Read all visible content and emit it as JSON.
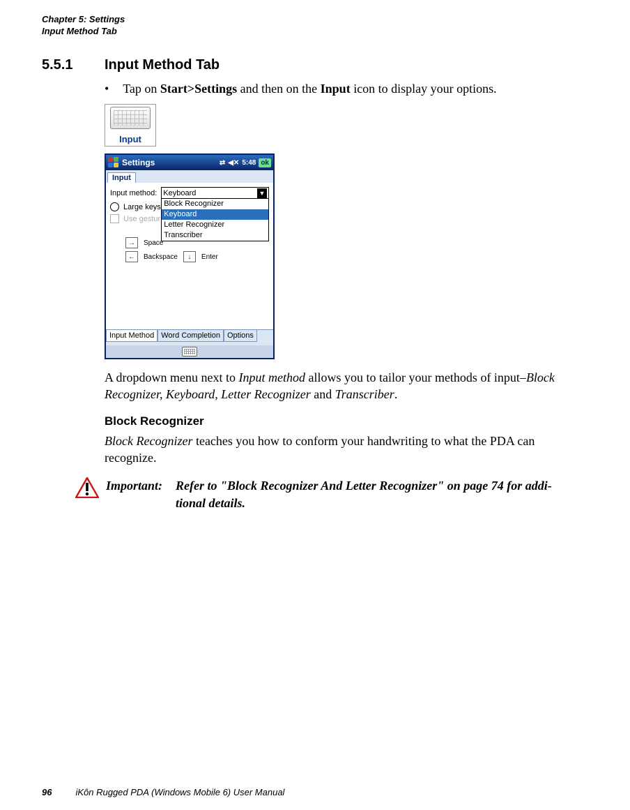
{
  "running_head": {
    "line1": "Chapter 5: Settings",
    "line2": "Input Method Tab"
  },
  "section": {
    "number": "5.5.1",
    "title": "Input Method Tab"
  },
  "bullet": {
    "marker": "•",
    "pre": "Tap on ",
    "bold1": "Start>Settings",
    "mid": " and then on the ",
    "bold2": "Input",
    "post": " icon to display your options."
  },
  "icon_tile": {
    "label": "Input"
  },
  "device": {
    "titlebar": {
      "title": "Settings",
      "signal_glyph": "⇄",
      "sound_glyph": "◀✕",
      "time": "5:48",
      "ok": "ok"
    },
    "top_tab": "Input",
    "panel": {
      "input_method_label": "Input method:",
      "selected": "Keyboard",
      "options": [
        "Block Recognizer",
        "Keyboard",
        "Letter Recognizer",
        "Transcriber"
      ],
      "large_keys": "Large keys",
      "use_gestures": "Use gestures",
      "space_label": "Space",
      "backspace_label": "Backspace",
      "enter_label": "Enter"
    },
    "bottom_tabs": [
      "Input Method",
      "Word Completion",
      "Options"
    ]
  },
  "paragraph1": {
    "pre": "A dropdown menu next to ",
    "it1": "Input method",
    "mid1": " allows you to tailor your methods of input–",
    "it2": "Block Recognizer, Keyboard, Letter Recognizer",
    "mid2": " and ",
    "it3": "Transcriber",
    "post": "."
  },
  "subhead": "Block Recognizer",
  "paragraph2": {
    "it1": "Block Recognizer",
    "rest": " teaches you how to conform your handwriting to what the PDA can recognize."
  },
  "callout": {
    "label": "Important:",
    "text_line1": "Refer to \"Block Recognizer And Letter Recognizer\" on page 74 for addi-",
    "text_line2": "tional details."
  },
  "footer": {
    "page": "96",
    "title": "iKôn Rugged PDA (Windows Mobile 6) User Manual"
  }
}
